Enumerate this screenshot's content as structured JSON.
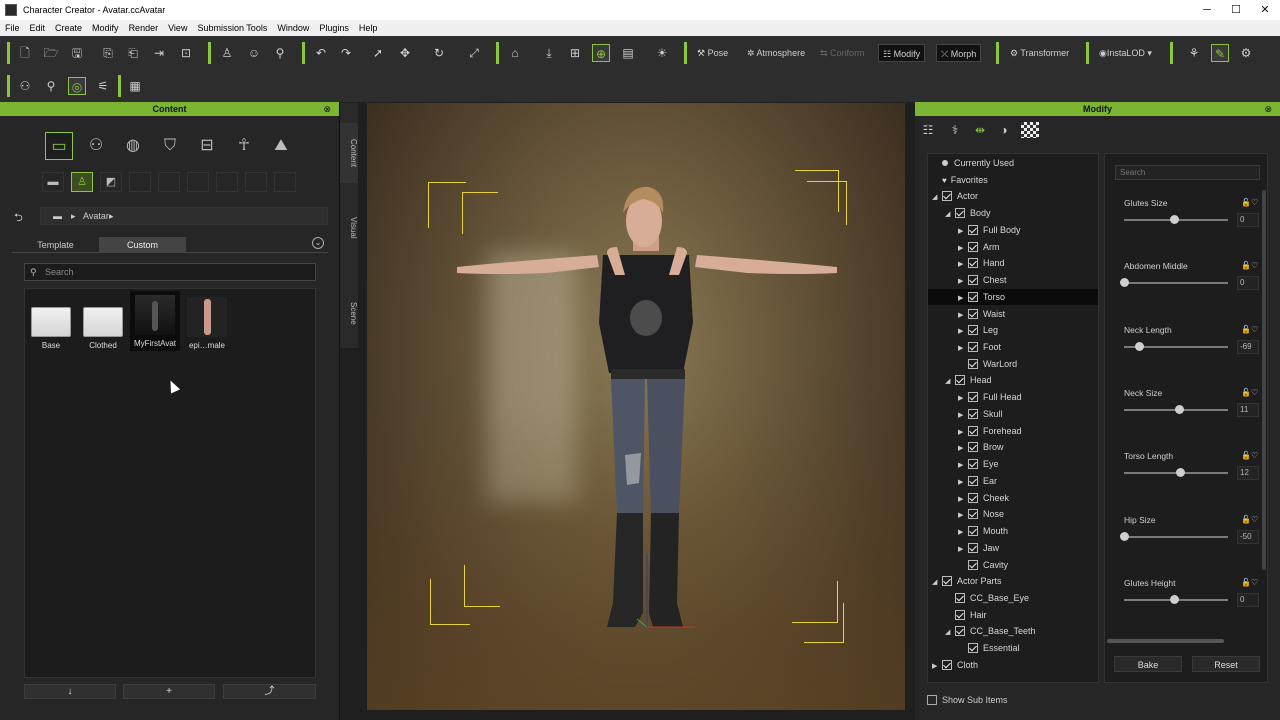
{
  "window": {
    "title": "Character Creator - Avatar.ccAvatar",
    "minimize": "─",
    "maximize": "☐",
    "close": "✕"
  },
  "menu": [
    "File",
    "Edit",
    "Create",
    "Modify",
    "Render",
    "View",
    "Submission Tools",
    "Window",
    "Plugins",
    "Help"
  ],
  "toolbar": {
    "pose": "Pose",
    "atmosphere": "Atmosphere",
    "conform": "Conform",
    "modify": "Modify",
    "morph": "Morph",
    "transformer": "Transformer",
    "instalod": "InstaLOD"
  },
  "content_panel": {
    "title": "Content",
    "side_tabs": [
      "Content",
      "Visual",
      "Scene"
    ],
    "breadcrumb": "Avatar",
    "tabs": [
      "Template",
      "Custom"
    ],
    "selected_tab": "Custom",
    "search_placeholder": "Search",
    "items": [
      {
        "caption": "Base",
        "kind": "folder"
      },
      {
        "caption": "Clothed",
        "kind": "folder"
      },
      {
        "caption": "MyFirstAvat",
        "kind": "avatar",
        "selected": true
      },
      {
        "caption": "epi…male",
        "kind": "avatar"
      }
    ],
    "bottom_buttons": [
      "↓",
      "+",
      "⤴"
    ]
  },
  "modify_panel": {
    "title": "Modify",
    "tree": [
      {
        "label": "Currently Used",
        "type": "dot",
        "indent": 0
      },
      {
        "label": "Favorites",
        "type": "heart",
        "indent": 0
      },
      {
        "label": "Actor",
        "type": "check",
        "expand": "open",
        "indent": 0
      },
      {
        "label": "Body",
        "type": "check",
        "expand": "open",
        "indent": 1
      },
      {
        "label": "Full Body",
        "type": "check",
        "expand": "closed",
        "indent": 2
      },
      {
        "label": "Arm",
        "type": "check",
        "expand": "closed",
        "indent": 2
      },
      {
        "label": "Hand",
        "type": "check",
        "expand": "closed",
        "indent": 2
      },
      {
        "label": "Chest",
        "type": "check",
        "expand": "closed",
        "indent": 2
      },
      {
        "label": "Torso",
        "type": "check",
        "expand": "closed",
        "indent": 2,
        "selected": true
      },
      {
        "label": "Waist",
        "type": "check",
        "expand": "closed",
        "indent": 2
      },
      {
        "label": "Leg",
        "type": "check",
        "expand": "closed",
        "indent": 2
      },
      {
        "label": "Foot",
        "type": "check",
        "expand": "closed",
        "indent": 2
      },
      {
        "label": "WarLord",
        "type": "check",
        "expand": "none",
        "indent": 2
      },
      {
        "label": "Head",
        "type": "check",
        "expand": "open",
        "indent": 1
      },
      {
        "label": "Full Head",
        "type": "check",
        "expand": "closed",
        "indent": 2
      },
      {
        "label": "Skull",
        "type": "check",
        "expand": "closed",
        "indent": 2
      },
      {
        "label": "Forehead",
        "type": "check",
        "expand": "closed",
        "indent": 2
      },
      {
        "label": "Brow",
        "type": "check",
        "expand": "closed",
        "indent": 2
      },
      {
        "label": "Eye",
        "type": "check",
        "expand": "closed",
        "indent": 2
      },
      {
        "label": "Ear",
        "type": "check",
        "expand": "closed",
        "indent": 2
      },
      {
        "label": "Cheek",
        "type": "check",
        "expand": "closed",
        "indent": 2
      },
      {
        "label": "Nose",
        "type": "check",
        "expand": "closed",
        "indent": 2
      },
      {
        "label": "Mouth",
        "type": "check",
        "expand": "closed",
        "indent": 2
      },
      {
        "label": "Jaw",
        "type": "check",
        "expand": "closed",
        "indent": 2
      },
      {
        "label": "Cavity",
        "type": "check",
        "expand": "none",
        "indent": 2
      },
      {
        "label": "Actor Parts",
        "type": "check",
        "expand": "open",
        "indent": 0
      },
      {
        "label": "CC_Base_Eye",
        "type": "check",
        "expand": "none",
        "indent": 1
      },
      {
        "label": "Hair",
        "type": "check",
        "expand": "none",
        "indent": 1
      },
      {
        "label": "CC_Base_Teeth",
        "type": "check",
        "expand": "open",
        "indent": 1
      },
      {
        "label": "Essential",
        "type": "check",
        "expand": "none",
        "indent": 2
      },
      {
        "label": "Cloth",
        "type": "check",
        "expand": "closed",
        "indent": 0
      }
    ],
    "search_placeholder": "Search",
    "sliders": [
      {
        "label": "Glutes Size",
        "value": "0",
        "position": 0.5
      },
      {
        "label": "Abdomen Middle",
        "value": "0",
        "position": 0.0
      },
      {
        "label": "Neck Length",
        "value": "-69",
        "position": 0.15
      },
      {
        "label": "Neck Size",
        "value": "11",
        "position": 0.55
      },
      {
        "label": "Torso Length",
        "value": "12",
        "position": 0.56
      },
      {
        "label": "Hip Size",
        "value": "-50",
        "position": 0.0
      },
      {
        "label": "Glutes Height",
        "value": "0",
        "position": 0.5
      }
    ],
    "bake": "Bake",
    "reset": "Reset",
    "show_sub_items": "Show Sub Items"
  },
  "colors": {
    "accent": "#8cc63f",
    "panel_header": "#7cb531",
    "bounding_box": "#e6d23a"
  }
}
